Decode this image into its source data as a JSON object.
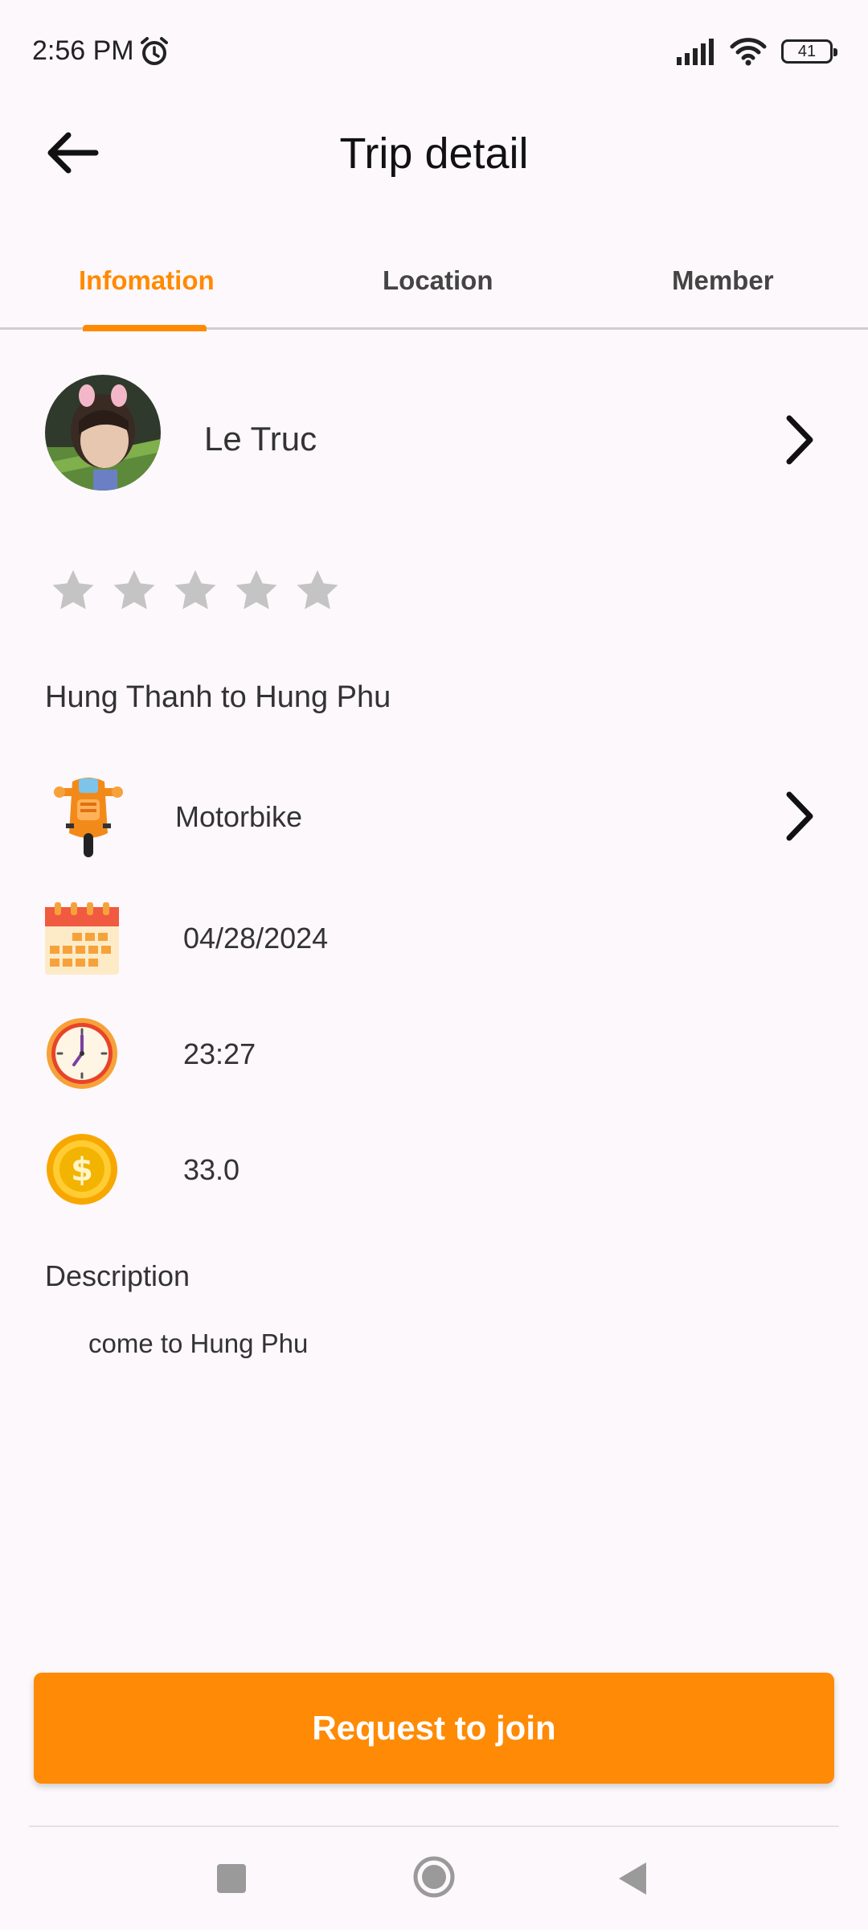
{
  "status_bar": {
    "time": "2:56 PM",
    "battery": "41"
  },
  "header": {
    "title": "Trip detail"
  },
  "tabs": [
    {
      "label": "Infomation",
      "active": true
    },
    {
      "label": "Location",
      "active": false
    },
    {
      "label": "Member",
      "active": false
    }
  ],
  "host": {
    "name": "Le Truc",
    "rating": 0,
    "max_rating": 5
  },
  "trip": {
    "route": "Hung Thanh to Hung Phu",
    "vehicle": "Motorbike",
    "date": "04/28/2024",
    "time": "23:27",
    "price": "33.0"
  },
  "description": {
    "label": "Description",
    "text": "come to Hung Phu"
  },
  "actions": {
    "join_label": "Request to join"
  },
  "colors": {
    "accent": "#ff8a00",
    "star_empty": "#c4c4c4",
    "background": "#fdf8fb"
  }
}
